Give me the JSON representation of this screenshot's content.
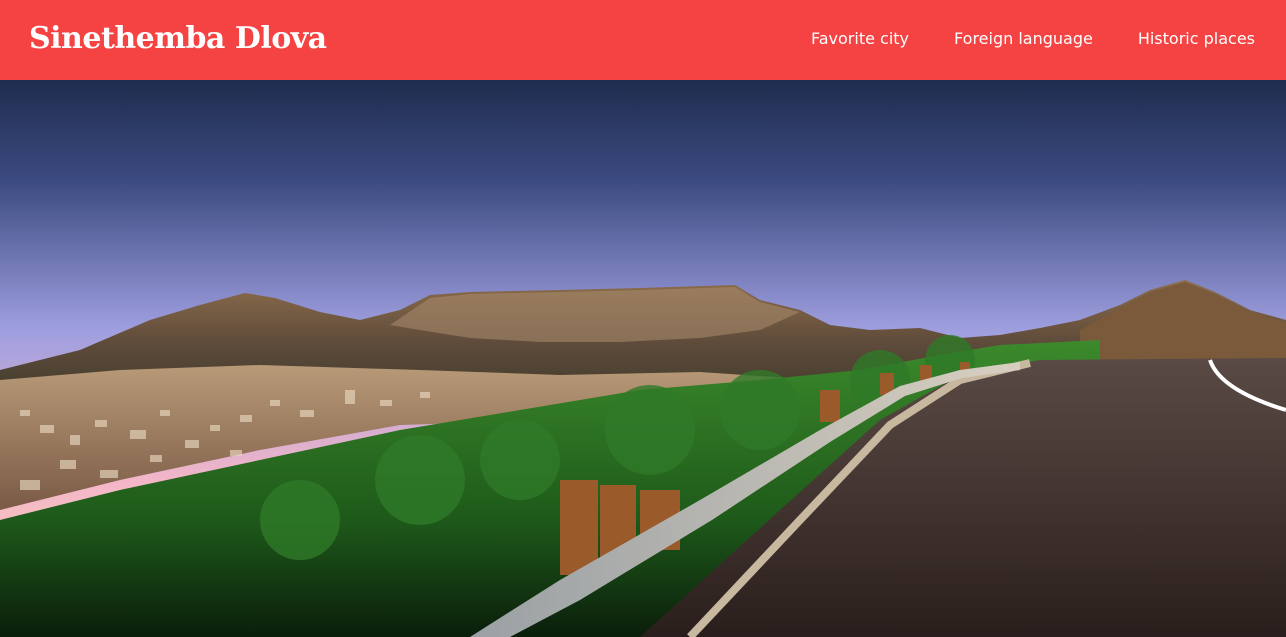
{
  "header": {
    "title": "Sinethemba Dlova",
    "background": "#f54343",
    "nav": [
      {
        "label": "Favorite city"
      },
      {
        "label": "Foreign language"
      },
      {
        "label": "Historic places"
      }
    ]
  },
  "hero": {
    "image": "hero-landscape-image"
  }
}
